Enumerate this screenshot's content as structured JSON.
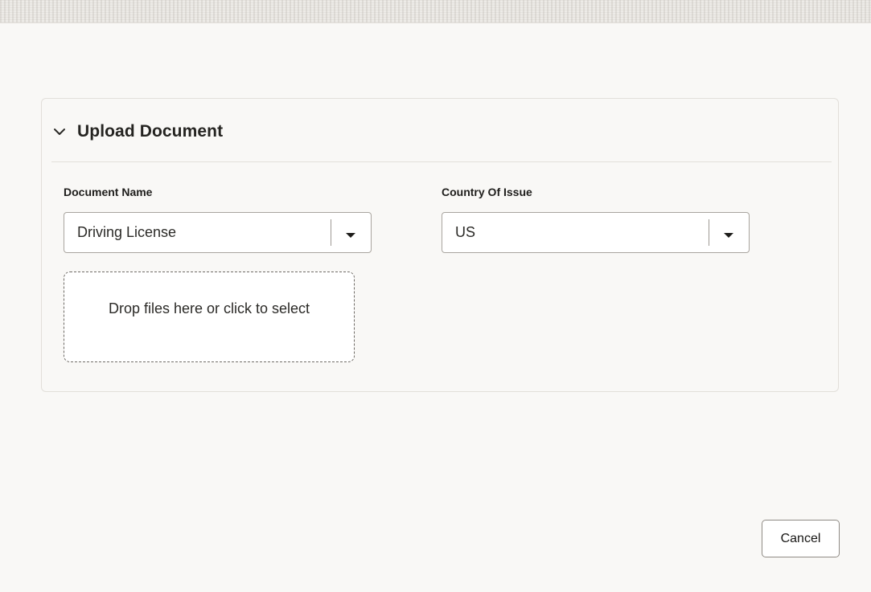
{
  "panel": {
    "title": "Upload Document",
    "expanded": true
  },
  "fields": {
    "document_name": {
      "label": "Document Name",
      "value": "Driving License"
    },
    "country_of_issue": {
      "label": "Country Of Issue",
      "value": "US"
    }
  },
  "dropzone": {
    "text": "Drop files here or click to select"
  },
  "footer": {
    "cancel_label": "Cancel"
  },
  "icons": {
    "collapse": "chevron-down-icon",
    "select_arrow": "caret-down-icon"
  },
  "colors": {
    "background": "#f9f8f6",
    "border": "#e2dfda",
    "field_border": "#a9a59f",
    "text": "#161513"
  }
}
